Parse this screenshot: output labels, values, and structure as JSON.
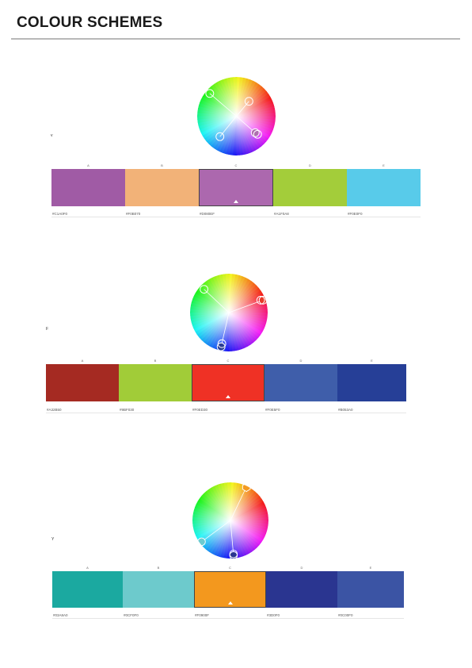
{
  "page": {
    "title": "COLOUR SCHEMES"
  },
  "schemes": [
    {
      "mark": "v",
      "swatches": [
        {
          "label": "A",
          "hex": "#C1A0F0",
          "color": "#A05BA5"
        },
        {
          "label": "B",
          "hex": "#F0B070",
          "color": "#F2B278"
        },
        {
          "label": "C",
          "hex": "#D080EF",
          "color": "#AC68AE",
          "selected": true
        },
        {
          "label": "D",
          "hex": "#A1F0A8",
          "color": "#A3CD3A"
        },
        {
          "label": "E",
          "hex": "#F0E0F0",
          "color": "#58CBEA"
        }
      ]
    },
    {
      "mark": "F",
      "swatches": [
        {
          "label": "A",
          "hex": "#A32B50",
          "color": "#A52A22"
        },
        {
          "label": "B",
          "hex": "#9BF030",
          "color": "#A1CC38"
        },
        {
          "label": "C",
          "hex": "#F0ED30",
          "color": "#EF3125",
          "selected": true
        },
        {
          "label": "D",
          "hex": "#F0E5F0",
          "color": "#3F5EAA"
        },
        {
          "label": "E",
          "hex": "#B053A0",
          "color": "#263F97"
        }
      ]
    },
    {
      "mark": "Y",
      "swatches": [
        {
          "label": "A",
          "hex": "#03A8A0",
          "color": "#1BA9A0"
        },
        {
          "label": "B",
          "hex": "#0CF0F0",
          "color": "#6DCACC"
        },
        {
          "label": "C",
          "hex": "#F0900F",
          "color": "#F3981E",
          "selected": true
        },
        {
          "label": "D",
          "hex": "#3D0F0",
          "color": "#2A3590"
        },
        {
          "label": "E",
          "hex": "#0C00F0",
          "color": "#3B54A4"
        }
      ]
    }
  ]
}
